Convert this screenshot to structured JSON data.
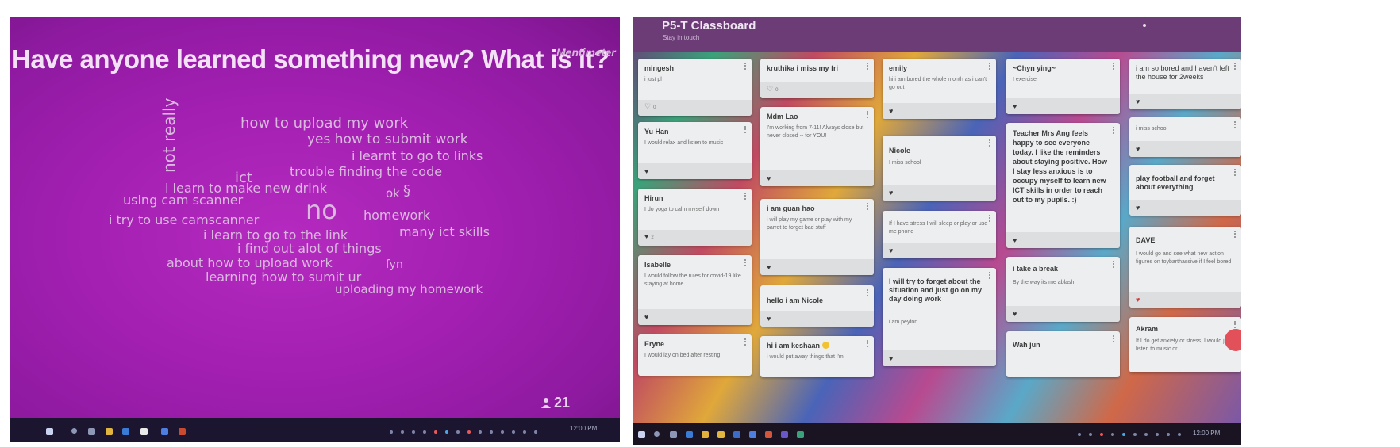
{
  "mentimeter": {
    "title": "Have anyone learned something new? What is it?",
    "brand": "Mentimeter",
    "participants": "21",
    "words": [
      {
        "text": "not really"
      },
      {
        "text": "how to upload my work"
      },
      {
        "text": "yes how to submit work"
      },
      {
        "text": "i learnt to go to links"
      },
      {
        "text": "trouble finding the code"
      },
      {
        "text": "ict"
      },
      {
        "text": "i learn to make new drink"
      },
      {
        "text": "using cam scanner"
      },
      {
        "text": "ok"
      },
      {
        "text": "§"
      },
      {
        "text": "no"
      },
      {
        "text": "homework"
      },
      {
        "text": "i try to use camscanner"
      },
      {
        "text": "many ict skills"
      },
      {
        "text": "i learn to go to the link"
      },
      {
        "text": "i find out alot of things"
      },
      {
        "text": "about how to upload work"
      },
      {
        "text": "fyn"
      },
      {
        "text": "learning how to sumit ur"
      },
      {
        "text": "uploading my homework"
      }
    ],
    "clock": "12:00 PM"
  },
  "padlet": {
    "title": "P5-T Classboard",
    "subtitle": "Stay in touch",
    "cards": [
      {
        "title": "mingesh",
        "body": "i just pl",
        "likes": "0",
        "heart": "outline"
      },
      {
        "title": "Yu Han",
        "body": "I would relax and listen to music",
        "likes": "",
        "heart": "solid"
      },
      {
        "title": "Hirun",
        "body": "I do yoga to calm myself down",
        "likes": "2",
        "heart": "solid"
      },
      {
        "title": "Isabelle",
        "body": "I would follow the rules for covid-19 like staying at home.",
        "likes": "",
        "heart": "solid"
      },
      {
        "title": "Eryne",
        "body": "I would lay on bed after resting",
        "likes": "",
        "heart": "none"
      },
      {
        "title": "kruthika i miss my fri",
        "body": "",
        "likes": "0",
        "heart": "outline"
      },
      {
        "title": "Mdm Lao",
        "body": "I'm working from 7-11! Always close but never closed -- for YOU!",
        "likes": "",
        "heart": "solid"
      },
      {
        "title": "i am guan hao",
        "body": "i will play my game or play with my parrot to forget bad stuff",
        "likes": "",
        "heart": "solid"
      },
      {
        "title": "hello i am Nicole",
        "body": "",
        "likes": "",
        "heart": "solid"
      },
      {
        "title": "hi i am keshaan",
        "body": "i would put away things that i'm",
        "likes": "",
        "heart": "none"
      },
      {
        "title": "emily",
        "body": "hi i am bored the whole month as i can't go out",
        "likes": "",
        "heart": "solid"
      },
      {
        "title": "Nicole",
        "body": "I miss school",
        "likes": "",
        "heart": "solid"
      },
      {
        "title": "",
        "body": "If I have stress I will sleep or play or use me phone",
        "likes": "",
        "heart": "solid"
      },
      {
        "title": "I will try to forget about the situation and just go on my day doing work",
        "body": "i am peyton",
        "likes": "",
        "heart": "solid"
      },
      {
        "title": "~Chyn ying~",
        "body": "I exercise",
        "likes": "",
        "heart": "solid"
      },
      {
        "title": "Teacher Mrs Ang feels happy to see everyone today. I like the reminders about staying positive. How I stay less anxious is to occupy myself to learn new ICT skills in order to reach out to my pupils. :)",
        "body": "",
        "likes": "",
        "heart": "solid"
      },
      {
        "title": "i take a break",
        "body": "By the way its me ablash",
        "likes": "",
        "heart": "solid"
      },
      {
        "title": "Wah jun",
        "body": "",
        "likes": "",
        "heart": "none"
      },
      {
        "title": "i am so bored and haven't left the house for 2weeks",
        "body": "",
        "likes": "",
        "heart": "solid"
      },
      {
        "title": "",
        "body": "i miss school",
        "likes": "",
        "heart": "solid"
      },
      {
        "title": "play football and forget about everything",
        "body": "",
        "likes": "",
        "heart": "solid"
      },
      {
        "title": "DAVE",
        "body": "I would go and see what new action figures on toybarthassive if I feel bored",
        "likes": "",
        "heart": "red"
      },
      {
        "title": "Akram",
        "body": "If I do get anxiety or stress, I would just listen to music or",
        "likes": "",
        "heart": "none"
      }
    ],
    "clock": "12:00 PM"
  },
  "colors": {
    "mentimeter_bg": "#a21fb1",
    "padlet_header": "#6c3c77",
    "card": "#eceeef"
  }
}
